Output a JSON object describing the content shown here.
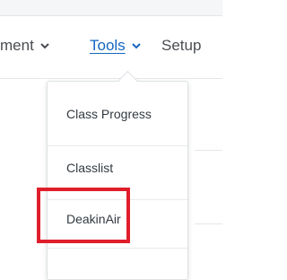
{
  "nav": {
    "items": [
      {
        "label": "ment",
        "has_chevron": true
      },
      {
        "label": "Tools",
        "has_chevron": true,
        "active": true
      },
      {
        "label": "Setup",
        "has_chevron": false
      }
    ]
  },
  "tools_menu": {
    "items": [
      "Class Progress",
      "Classlist",
      "DeakinAir"
    ]
  },
  "colors": {
    "nav_text": "#4a4d52",
    "active_link": "#1566c0",
    "highlight_box": "#e01e2b"
  }
}
